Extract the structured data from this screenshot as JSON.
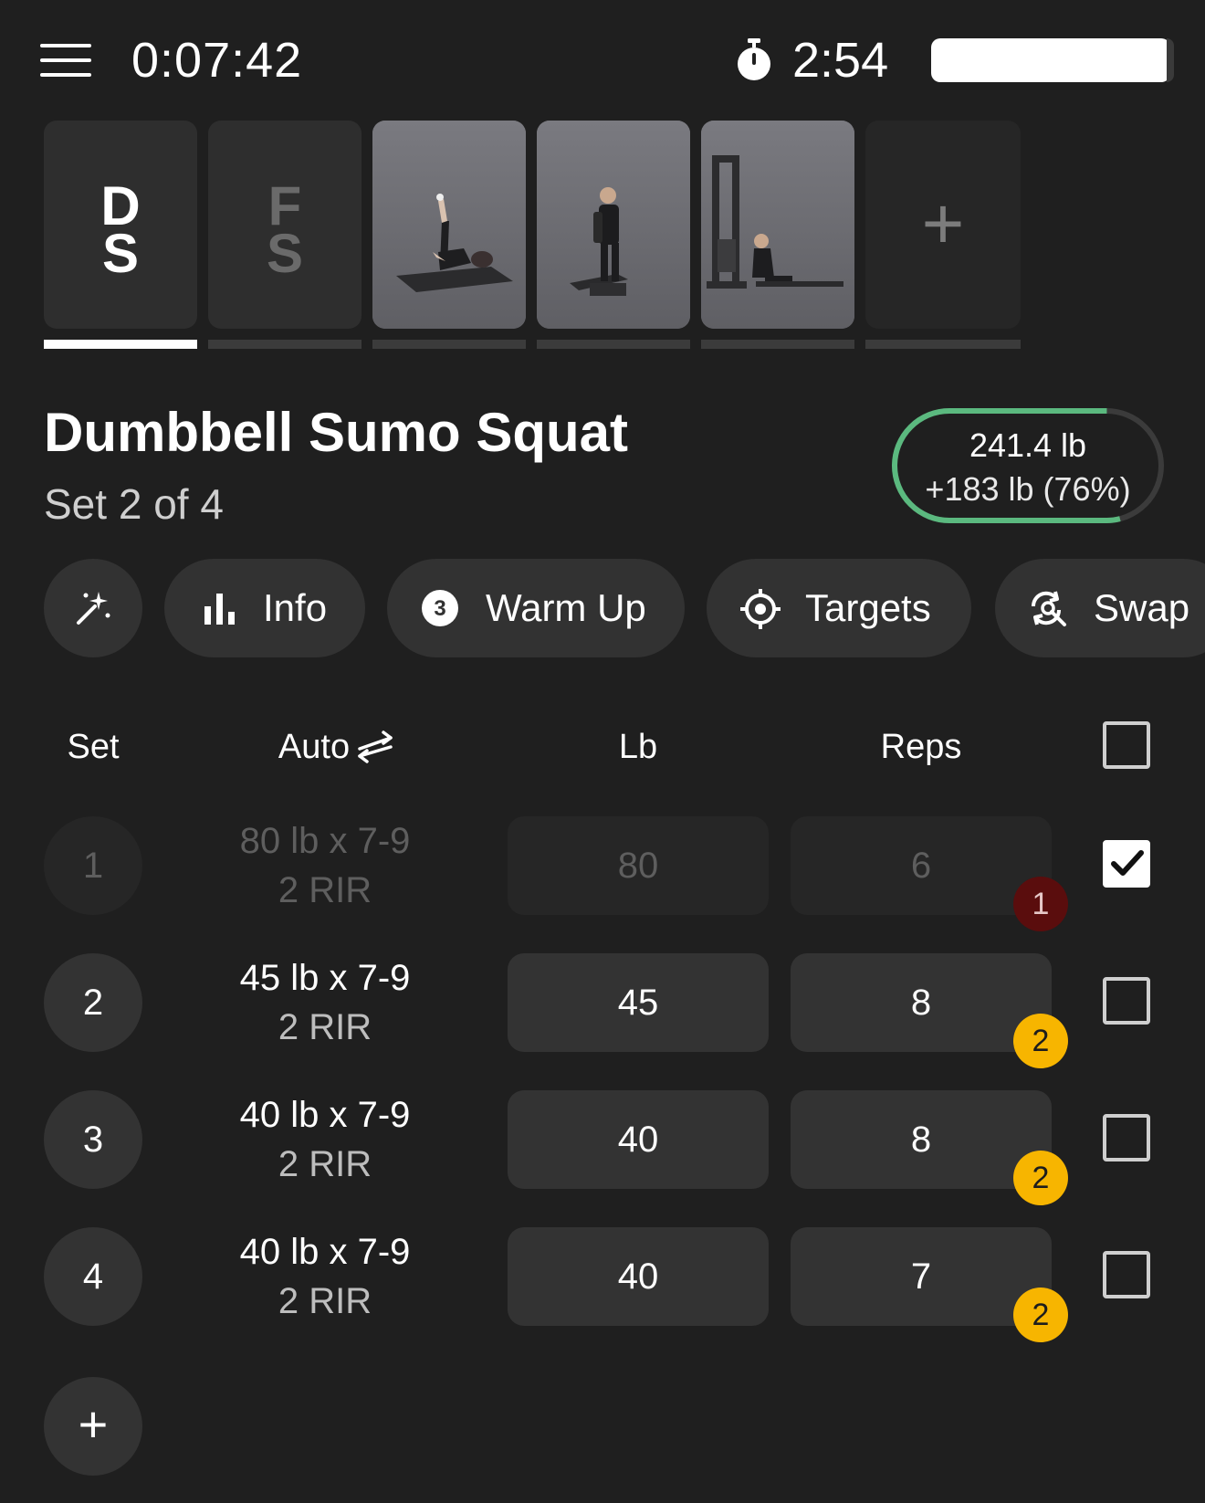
{
  "topbar": {
    "menu_icon": "hamburger-menu-icon",
    "elapsed_time": "0:07:42",
    "timer_icon": "stopwatch-icon",
    "rest_time": "2:54"
  },
  "tiles": [
    {
      "kind": "initials",
      "line1": "D",
      "line2": "S",
      "active": true
    },
    {
      "kind": "initials",
      "line1": "F",
      "line2": "S",
      "active": false
    },
    {
      "kind": "photo",
      "active": false
    },
    {
      "kind": "photo",
      "active": false
    },
    {
      "kind": "photo",
      "active": false
    },
    {
      "kind": "add",
      "glyph": "+",
      "active": false
    }
  ],
  "exercise": {
    "title": "Dumbbell Sumo Squat",
    "subtitle": "Set 2 of 4",
    "volume": "241.4 lb",
    "volume_delta": "+183 lb (76%)",
    "volume_progress": 0.76,
    "progress_color": "#5bb97f"
  },
  "chips": {
    "magic_icon": "magic-wand-icon",
    "info": "Info",
    "info_icon": "bar-chart-icon",
    "warmup": "Warm Up",
    "warmup_icon": "number-3-circle-icon",
    "warmup_badge": "3",
    "targets": "Targets",
    "targets_icon": "crosshair-icon",
    "swap": "Swap",
    "swap_icon": "swap-search-icon"
  },
  "table": {
    "headers": {
      "set": "Set",
      "auto": "Auto",
      "auto_icon": "swap-arrows-icon",
      "lb": "Lb",
      "reps": "Reps"
    },
    "rows": [
      {
        "set": "1",
        "auto": "80 lb x 7-9",
        "rir": "2 RIR",
        "lb": "80",
        "reps": "6",
        "badge": "1",
        "done": true
      },
      {
        "set": "2",
        "auto": "45 lb x 7-9",
        "rir": "2 RIR",
        "lb": "45",
        "reps": "8",
        "badge": "2",
        "done": false
      },
      {
        "set": "3",
        "auto": "40 lb x 7-9",
        "rir": "2 RIR",
        "lb": "40",
        "reps": "8",
        "badge": "2",
        "done": false
      },
      {
        "set": "4",
        "auto": "40 lb x 7-9",
        "rir": "2 RIR",
        "lb": "40",
        "reps": "7",
        "badge": "2",
        "done": false
      }
    ],
    "add_set": "+"
  },
  "colors": {
    "background": "#1f1f1f",
    "badge_gold": "#f7b500",
    "badge_red": "#5a0d0d",
    "progress_green": "#5bb97f"
  }
}
